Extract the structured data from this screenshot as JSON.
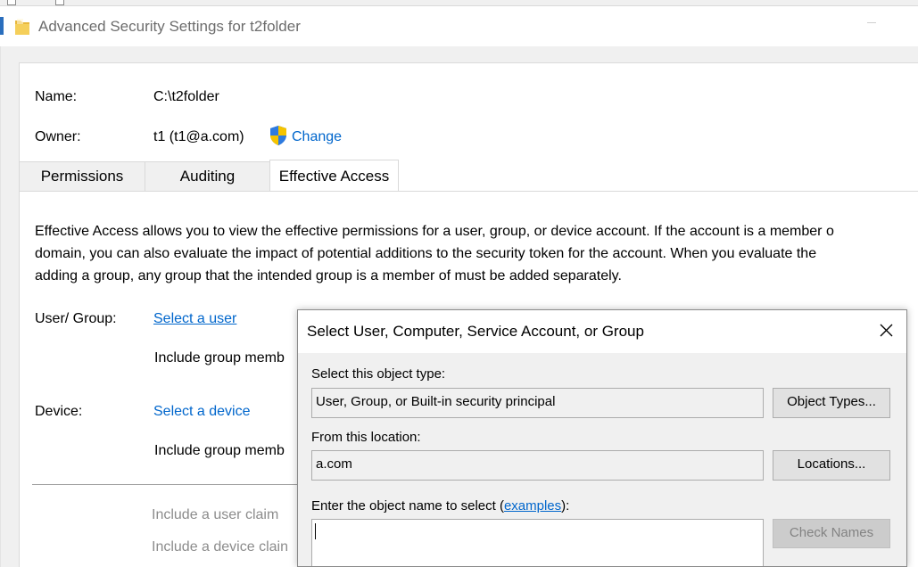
{
  "window": {
    "title": "Advanced Security Settings for t2folder"
  },
  "info": {
    "name_label": "Name:",
    "name_value": "C:\\t2folder",
    "owner_label": "Owner:",
    "owner_value": "t1 (t1@a.com)",
    "change_link": "Change",
    "change_icon": "uac-shield-icon"
  },
  "tabs": [
    {
      "label": "Permissions",
      "active": false
    },
    {
      "label": "Auditing",
      "active": false
    },
    {
      "label": "Effective Access",
      "active": true
    }
  ],
  "effective_access": {
    "description_lines": [
      "Effective Access allows you to view the effective permissions for a user, group, or device account. If the account is a member o",
      "domain, you can also evaluate the impact of potential additions to the security token for the account. When you evaluate the",
      "adding a group, any group that the intended group is a member of must be added separately."
    ],
    "user_group_label": "User/ Group:",
    "select_user_link": "Select a user",
    "include_group_user": "Include group memb",
    "device_label": "Device:",
    "select_device_link": "Select a device",
    "include_group_device": "Include group memb",
    "include_user_claim": "Include a user claim",
    "include_device_claim": "Include a device clain"
  },
  "dialog": {
    "title": "Select User, Computer, Service Account, or Group",
    "object_type_label": "Select this object type:",
    "object_type_value": "User, Group, or Built-in security principal",
    "object_types_button": "Object Types...",
    "location_label": "From this location:",
    "location_value": "a.com",
    "locations_button": "Locations...",
    "enter_name_label_prefix": "Enter the object name to select (",
    "examples_link": "examples",
    "enter_name_label_suffix": "):",
    "object_name_value": "",
    "check_names_button": "Check Names"
  },
  "colors": {
    "link": "#0066cc",
    "window_bg": "#f0f0f0",
    "accent": "#2a6ebd"
  }
}
